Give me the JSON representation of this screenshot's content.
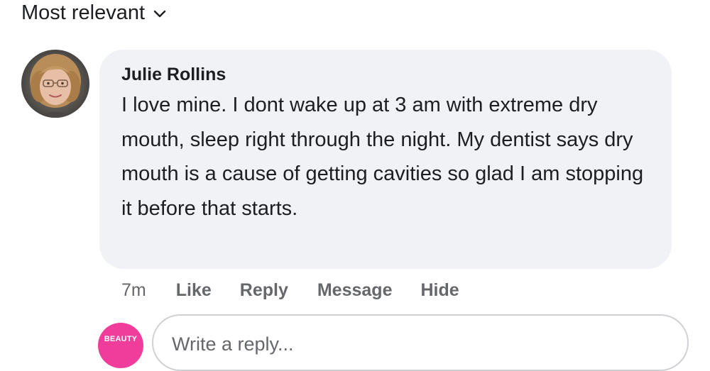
{
  "sort": {
    "label": "Most relevant",
    "icon": "chevron-down-icon"
  },
  "comment": {
    "author": "Julie Rollins",
    "text": "I love mine. I dont wake up at 3 am with extreme dry mouth, sleep right through the night. My dentist says dry mouth is a cause of getting cavities so glad I am stopping it before that starts.",
    "time": "7m",
    "actions": {
      "like": "Like",
      "reply": "Reply",
      "message": "Message",
      "hide": "Hide"
    }
  },
  "reply": {
    "avatar_text": "BEAUTY",
    "placeholder": "Write a reply..."
  },
  "colors": {
    "bubble": "#f0f2f5",
    "secondary_text": "#65676b",
    "primary_text": "#1c1e21",
    "reply_avatar": "#f03d9c"
  }
}
